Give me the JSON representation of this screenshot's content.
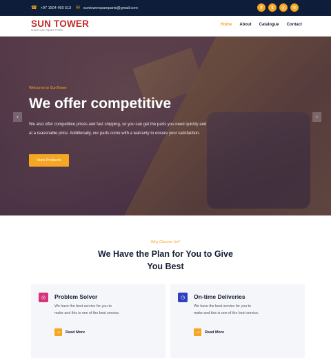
{
  "topbar": {
    "phone": "+97 1504 450 513",
    "email": "suntowerspareparts@gmail.com",
    "phone_icon": "phone-icon",
    "email_icon": "envelope-icon",
    "socials": [
      {
        "icon": "facebook-icon",
        "glyph": "f"
      },
      {
        "icon": "twitter-icon",
        "glyph": "t"
      },
      {
        "icon": "instagram-icon",
        "glyph": "◎"
      },
      {
        "icon": "email-icon",
        "glyph": "✉"
      }
    ],
    "accent": "#f5a623",
    "background": "#0e1d3a"
  },
  "header": {
    "logo": "SUN TOWER",
    "tagline": "Used Auto Spare Parts",
    "logo_color": "#c62828",
    "nav": [
      {
        "label": "Home",
        "active": true
      },
      {
        "label": "About",
        "active": false
      },
      {
        "label": "Catalogue",
        "active": false
      },
      {
        "label": "Contact",
        "active": false
      }
    ]
  },
  "hero": {
    "kicker": "Welcome to SunTower",
    "title": "We offer competitive",
    "text": "We also offer competitive prices and fast shipping, so you can get the parts you need quickly and at a reasonable price. Additionally, our parts come with a warranty to ensure your satisfaction.",
    "button": "View Products",
    "prev_icon": "chevron-left-icon",
    "next_icon": "chevron-right-icon"
  },
  "why": {
    "kicker": "Why Choose Us?",
    "title": "We Have the Plan for You to Give You Best",
    "cards": [
      {
        "icon": "target-icon",
        "title": "Problem Solver",
        "text": "We have the best service for you to make and this is one of the best service.",
        "button": "Read More"
      },
      {
        "icon": "clock-icon",
        "title": "On-time Deliveries",
        "text": "We have the best service for you to make and this is one of the best service.",
        "button": "Read More"
      }
    ]
  }
}
